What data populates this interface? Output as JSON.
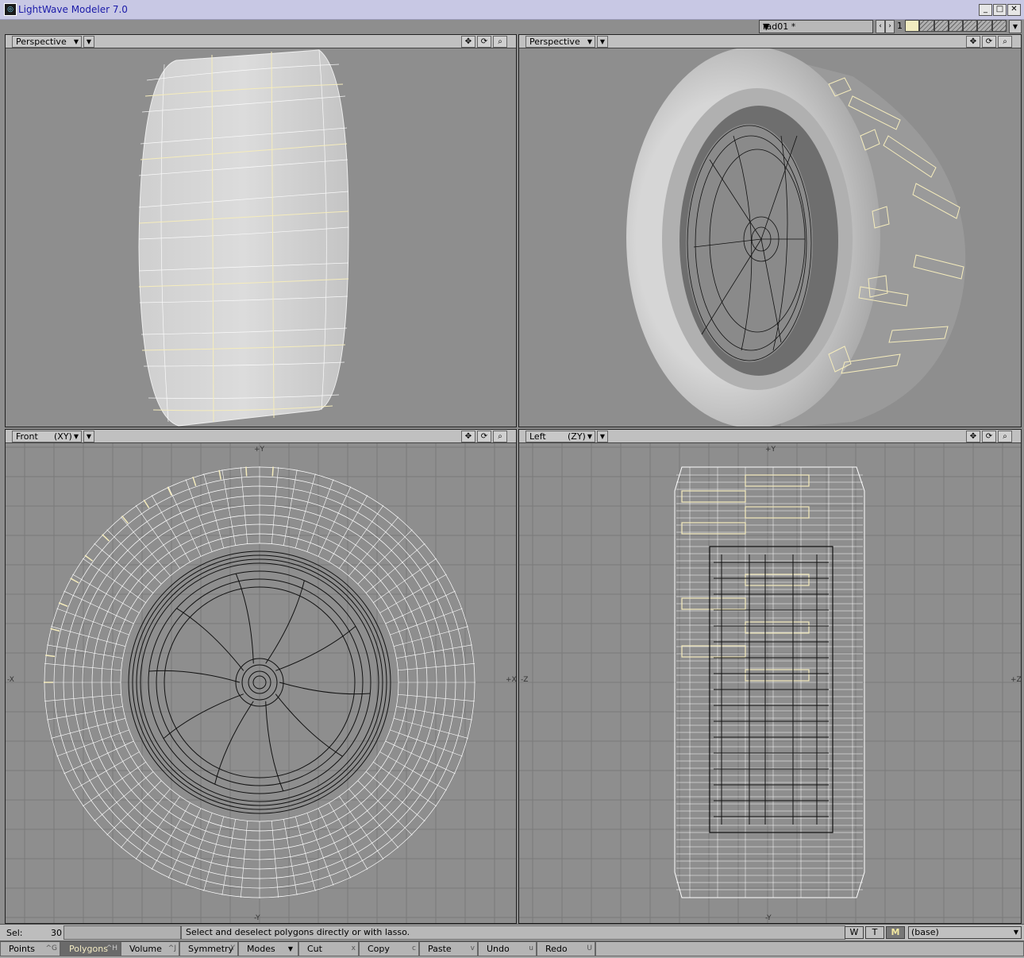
{
  "window": {
    "title": "LightWave Modeler 7.0",
    "icon": "modeler-app-icon"
  },
  "layers": {
    "object_name": "rad01 *",
    "layer_number": "1",
    "cells": 7,
    "active_cell": 0
  },
  "viewports": [
    {
      "id": "tl",
      "label": "Perspective",
      "axis": "",
      "mode": "shaded-wireframe"
    },
    {
      "id": "tr",
      "label": "Perspective",
      "axis": "",
      "mode": "smooth-shaded"
    },
    {
      "id": "bl",
      "label": "Front",
      "axis": "(XY)",
      "mode": "wireframe",
      "axis_labels": {
        "top": "+Y",
        "bottom": "-Y",
        "left": "-X",
        "right": "+X"
      }
    },
    {
      "id": "br",
      "label": "Left",
      "axis": "(ZY)",
      "mode": "wireframe",
      "axis_labels": {
        "top": "+Y",
        "bottom": "-Y",
        "left": "-Z",
        "right": "+Z"
      }
    }
  ],
  "status": {
    "sel_label": "Sel:",
    "sel_count": "30",
    "message": "Select and deselect polygons directly or with lasso.",
    "w": "W",
    "t": "T",
    "m": "M",
    "layer_select": "(base)"
  },
  "bottom": {
    "points": "Points",
    "points_sc": "^G",
    "polygons": "Polygons",
    "polygons_sc": "^H",
    "volume": "Volume",
    "volume_sc": "^J",
    "symmetry": "Symmetry",
    "symmetry_sc": "Y",
    "modes": "Modes",
    "cut": "Cut",
    "cut_sc": "x",
    "copy": "Copy",
    "copy_sc": "c",
    "paste": "Paste",
    "paste_sc": "v",
    "undo": "Undo",
    "undo_sc": "u",
    "redo": "Redo",
    "redo_sc": "U"
  },
  "colors": {
    "selected": "#f5ecbc",
    "wire": "#ffffff",
    "mesh": "#111111",
    "viewport_bg": "#8e8e8e"
  }
}
